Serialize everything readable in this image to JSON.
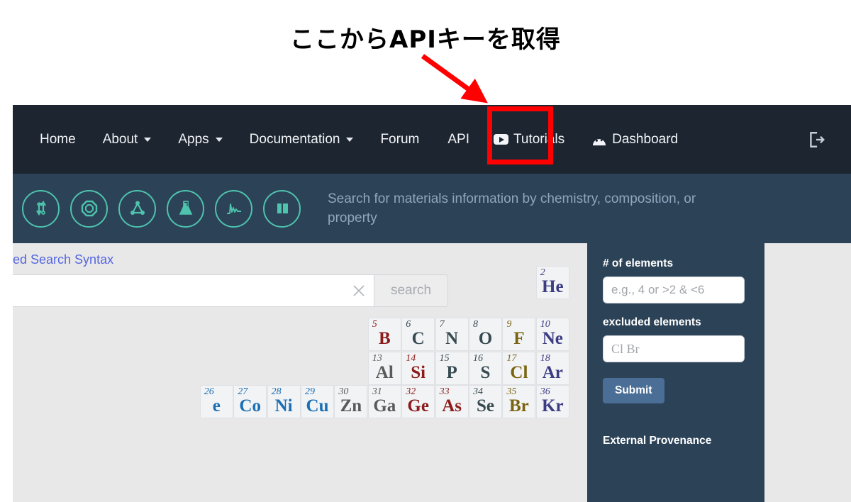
{
  "annotation": {
    "text": "ここからAPIキーを取得",
    "arrow_color": "#ff0000",
    "highlight_color": "#ff0000",
    "highlight_target": "API"
  },
  "navbar": {
    "background": "#1d2530",
    "items": [
      {
        "label": "Home",
        "caret": false,
        "icon": null
      },
      {
        "label": "About",
        "caret": true,
        "icon": null
      },
      {
        "label": "Apps",
        "caret": true,
        "icon": null
      },
      {
        "label": "Documentation",
        "caret": true,
        "icon": null
      },
      {
        "label": "Forum",
        "caret": false,
        "icon": null
      },
      {
        "label": "API",
        "caret": false,
        "icon": null
      },
      {
        "label": "Tutorials",
        "caret": false,
        "icon": "video-play-icon"
      },
      {
        "label": "Dashboard",
        "caret": false,
        "icon": "gauge-icon"
      }
    ],
    "signout_icon": "sign-out-icon"
  },
  "iconbar": {
    "background": "#2c4257",
    "accent": "#4ec3ad",
    "icons": [
      "battery-arrows-icon",
      "crystal-structure-icon",
      "molecule-icon",
      "flask-icon",
      "spectrum-icon",
      "panel-book-icon"
    ],
    "tagline": "Search for materials information by chemistry, composition, or property"
  },
  "search": {
    "syntax_link": "ed Search Syntax",
    "input_value": "",
    "clear_icon": "close-x-icon",
    "button_label": "search"
  },
  "filters": {
    "num_elements_label": "# of elements",
    "num_elements_placeholder": "e.g., 4 or >2 & <6",
    "excluded_elements_label": "excluded elements",
    "excluded_elements_placeholder": "Cl Br",
    "submit_label": "Submit",
    "provenance_label": "External Provenance"
  },
  "periodic_table": {
    "colors": {
      "noble": "#3c3c82",
      "metalloid": "#8c1c1c",
      "nonmetal": "#374a52",
      "halogen": "#7a6410",
      "metal": "#5a5a5a",
      "transition": "#1a6fb5"
    },
    "elements": [
      {
        "num": "2",
        "sym": "He",
        "col": 18,
        "row": 1,
        "color": "noble"
      },
      {
        "num": "5",
        "sym": "B",
        "col": 13,
        "row": 2,
        "color": "metalloid"
      },
      {
        "num": "6",
        "sym": "C",
        "col": 14,
        "row": 2,
        "color": "nonmetal"
      },
      {
        "num": "7",
        "sym": "N",
        "col": 15,
        "row": 2,
        "color": "nonmetal"
      },
      {
        "num": "8",
        "sym": "O",
        "col": 16,
        "row": 2,
        "color": "nonmetal"
      },
      {
        "num": "9",
        "sym": "F",
        "col": 17,
        "row": 2,
        "color": "halogen"
      },
      {
        "num": "10",
        "sym": "Ne",
        "col": 18,
        "row": 2,
        "color": "noble"
      },
      {
        "num": "13",
        "sym": "Al",
        "col": 13,
        "row": 3,
        "color": "metal"
      },
      {
        "num": "14",
        "sym": "Si",
        "col": 14,
        "row": 3,
        "color": "metalloid"
      },
      {
        "num": "15",
        "sym": "P",
        "col": 15,
        "row": 3,
        "color": "nonmetal"
      },
      {
        "num": "16",
        "sym": "S",
        "col": 16,
        "row": 3,
        "color": "nonmetal"
      },
      {
        "num": "17",
        "sym": "Cl",
        "col": 17,
        "row": 3,
        "color": "halogen"
      },
      {
        "num": "18",
        "sym": "Ar",
        "col": 18,
        "row": 3,
        "color": "noble"
      },
      {
        "num": "26",
        "sym": "e",
        "col": 8,
        "row": 4,
        "color": "transition"
      },
      {
        "num": "27",
        "sym": "Co",
        "col": 9,
        "row": 4,
        "color": "transition"
      },
      {
        "num": "28",
        "sym": "Ni",
        "col": 10,
        "row": 4,
        "color": "transition"
      },
      {
        "num": "29",
        "sym": "Cu",
        "col": 11,
        "row": 4,
        "color": "transition"
      },
      {
        "num": "30",
        "sym": "Zn",
        "col": 12,
        "row": 4,
        "color": "metal"
      },
      {
        "num": "31",
        "sym": "Ga",
        "col": 13,
        "row": 4,
        "color": "metal"
      },
      {
        "num": "32",
        "sym": "Ge",
        "col": 14,
        "row": 4,
        "color": "metalloid"
      },
      {
        "num": "33",
        "sym": "As",
        "col": 15,
        "row": 4,
        "color": "metalloid"
      },
      {
        "num": "34",
        "sym": "Se",
        "col": 16,
        "row": 4,
        "color": "nonmetal"
      },
      {
        "num": "35",
        "sym": "Br",
        "col": 17,
        "row": 4,
        "color": "halogen"
      },
      {
        "num": "36",
        "sym": "Kr",
        "col": 18,
        "row": 4,
        "color": "noble"
      }
    ]
  }
}
